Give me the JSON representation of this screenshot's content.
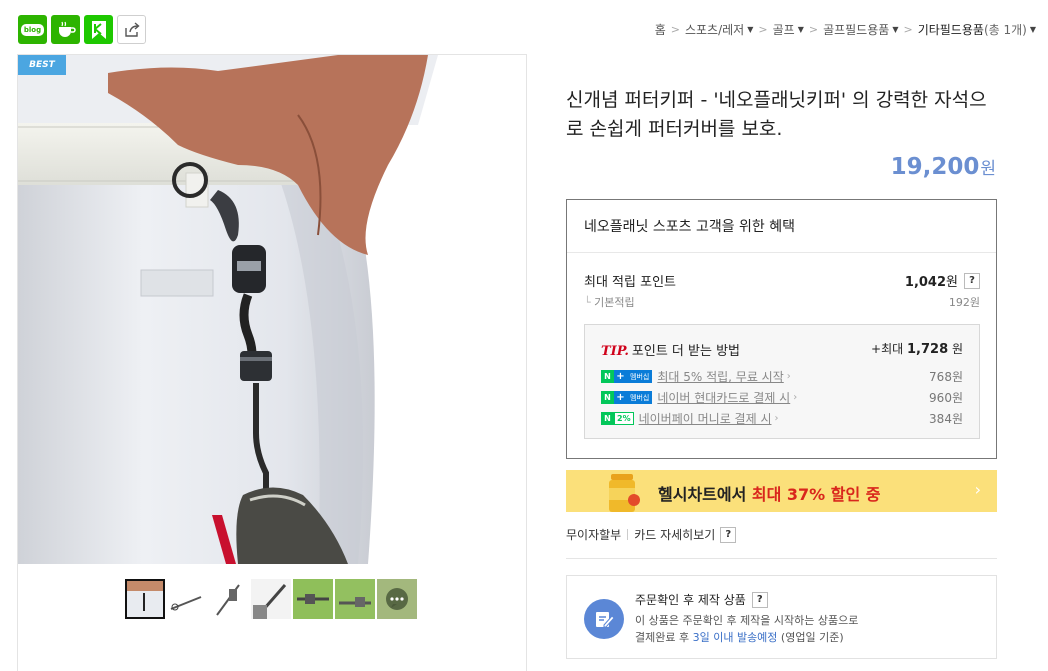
{
  "share": {
    "blog_label": "blog",
    "icons": [
      "blog-icon",
      "cafe-icon",
      "kakaostory-icon",
      "share-icon"
    ]
  },
  "breadcrumb": {
    "items": [
      "홈",
      "스포츠/레저",
      "골프",
      "골프필드용품",
      "기타필드용품"
    ],
    "count": "(총 1개)"
  },
  "image": {
    "badge": "BEST",
    "thumbnails": 7,
    "selected_thumbnail": 1
  },
  "product": {
    "title": "신개념 퍼터키퍼 - '네오플래닛키퍼' 의 강력한 자석으로 손쉽게 퍼터커버를 보호.",
    "price": "19,200",
    "price_unit": "원"
  },
  "benefit": {
    "header": "네오플래닛 스포츠 고객을 위한 혜택",
    "max_points_label": "최대 적립 포인트",
    "max_points_value": "1,042",
    "max_points_unit": "원",
    "help": "?",
    "basic_label": "기본적립",
    "basic_value": "192원",
    "tip": {
      "tip_word": "TIP.",
      "title": "포인트 더 받는 방법",
      "max_prefix": "+최대",
      "max_value": "1,728",
      "max_unit": "원",
      "lines": [
        {
          "badge_n": "N",
          "badge_plus": "+",
          "badge_text": "멤버십",
          "text": "최대 5% 적립, 무료 시작",
          "amount": "768원"
        },
        {
          "badge_n": "N",
          "badge_plus": "+",
          "badge_text": "멤버십",
          "text": "네이버 현대카드로 결제 시",
          "amount": "960원"
        },
        {
          "badge_n": "N",
          "badge_pct": "2%",
          "text": "네이버페이 머니로 결제 시",
          "amount": "384원"
        }
      ]
    }
  },
  "banner": {
    "text_prefix": "헬시차트에서 ",
    "text_highlight": "최대 37% 할인 중",
    "arrow": "›"
  },
  "card": {
    "installment": "무이자할부",
    "detail": "카드 자세히보기",
    "help": "?"
  },
  "order": {
    "title": "주문확인 후 제작 상품",
    "help": "?",
    "line1": "이 상품은 주문확인 후 제작을 시작하는 상품으로",
    "line2_prefix": "결제완료 후 ",
    "line2_highlight": "3일 이내 발송예정",
    "line2_suffix": " (영업일 기준)"
  },
  "colors": {
    "price": "#6b8fd1",
    "naver_green": "#03c75a",
    "banner_bg": "#fbe07a",
    "banner_red": "#d9261c",
    "best_badge": "#4ba6e1"
  }
}
